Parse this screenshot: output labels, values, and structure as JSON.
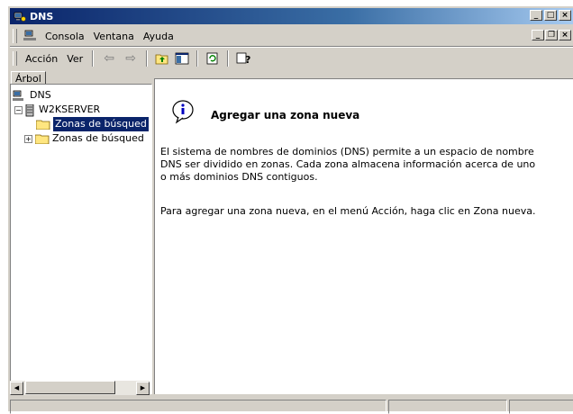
{
  "window": {
    "title": "DNS"
  },
  "menubar": {
    "items": [
      "Consola",
      "Ventana",
      "Ayuda"
    ]
  },
  "toolbar": {
    "action_label": "Acción",
    "view_label": "Ver"
  },
  "tree": {
    "tab_label": "Árbol",
    "nodes": [
      {
        "label": "DNS",
        "level": 0
      },
      {
        "label": "W2KSERVER",
        "level": 1
      },
      {
        "label": "Zonas de búsqued",
        "level": 2,
        "selected": true
      },
      {
        "label": "Zonas de búsqued",
        "level": 2
      }
    ]
  },
  "content": {
    "heading": "Agregar una zona nueva",
    "paragraph1": "El sistema de nombres de dominios (DNS) permite a un espacio de nombre DNS ser dividido en zonas. Cada zona almacena información acerca de uno o más dominios DNS contiguos.",
    "paragraph2": "Para agregar una zona nueva, en el menú Acción, haga clic en Zona nueva."
  },
  "colors": {
    "titlebar_start": "#0a246a",
    "selection": "#0a246a",
    "face": "#d4d0c8"
  }
}
